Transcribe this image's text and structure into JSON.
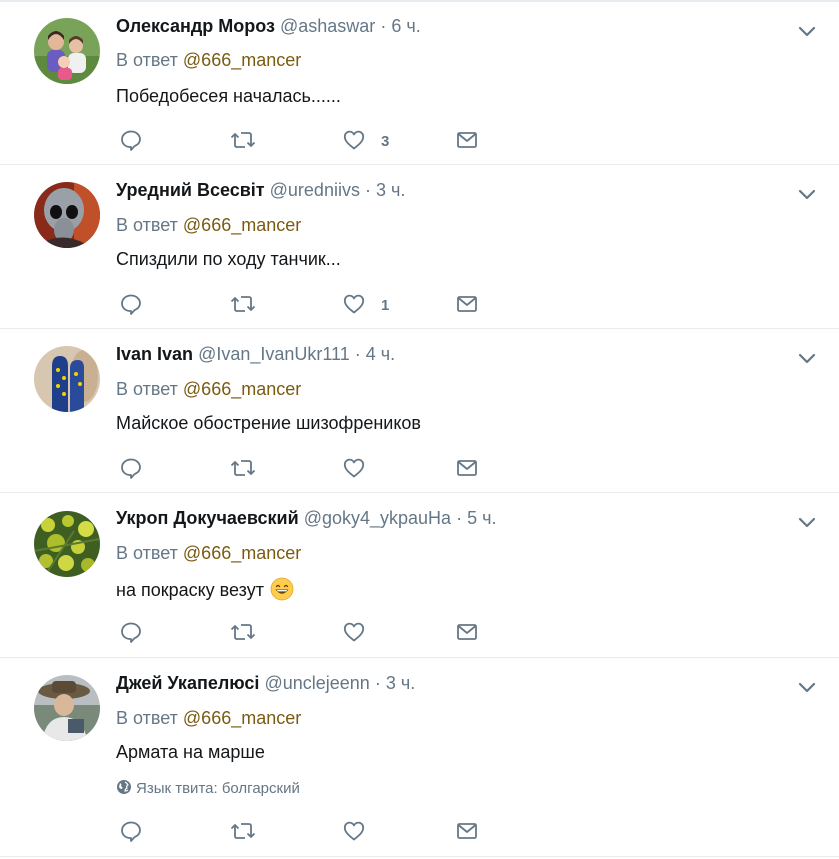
{
  "colors": {
    "text": "#14171a",
    "muted": "#657786",
    "mention": "#7a5b12",
    "divider": "#e6ecf0"
  },
  "icons": {
    "reply": "reply-icon",
    "retweet": "retweet-icon",
    "like": "heart-icon",
    "dm": "envelope-icon",
    "caret": "chevron-down-icon",
    "globe": "globe-icon"
  },
  "tweets": [
    {
      "name": "Олександр Мороз",
      "handle": "@ashaswar",
      "separator": "·",
      "time": "6 ч.",
      "reply_prefix": "В ответ",
      "reply_to": "@666_mancer",
      "text": "Победобесея началась......",
      "like_count": "3"
    },
    {
      "name": "Уредний Всесвіт",
      "handle": "@uredniivs",
      "separator": "·",
      "time": "3 ч.",
      "reply_prefix": "В ответ",
      "reply_to": "@666_mancer",
      "text": "Спиздили по ходу танчик...",
      "like_count": "1"
    },
    {
      "name": "Ivan Ivan",
      "handle": "@Ivan_IvanUkr111",
      "separator": "·",
      "time": "4 ч.",
      "reply_prefix": "В ответ",
      "reply_to": "@666_mancer",
      "text": "Майское обострение шизофреников",
      "like_count": ""
    },
    {
      "name": "Укроп Докучаевский",
      "handle": "@goky4_ykpauHa",
      "separator": "·",
      "time": "5 ч.",
      "reply_prefix": "В ответ",
      "reply_to": "@666_mancer",
      "text": "на покраску везут",
      "emoji": "grinning-face-emoji",
      "like_count": ""
    },
    {
      "name": "Джей Укапелюсі",
      "handle": "@unclejeenn",
      "separator": "·",
      "time": "3 ч.",
      "reply_prefix": "В ответ",
      "reply_to": "@666_mancer",
      "text": "Армата на марше",
      "language_note": "Язык твита: болгарский",
      "like_count": ""
    }
  ]
}
